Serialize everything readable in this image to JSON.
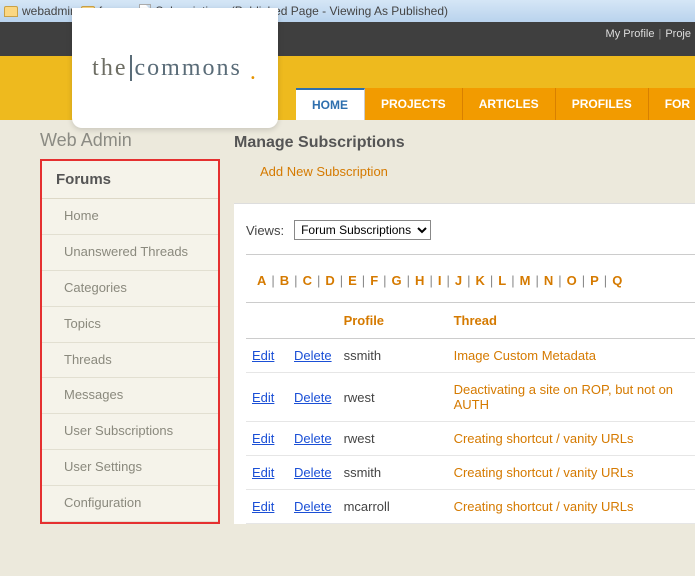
{
  "breadcrumb": {
    "item1": "webadmin",
    "item2": "forums",
    "item3": "Subscriptions (Published Page - Viewing As Published)"
  },
  "darkbar": {
    "my_profile": "My Profile",
    "proj": "Proje"
  },
  "logo": {
    "left": "the",
    "right": "commons",
    "dot": "."
  },
  "tabs": [
    {
      "label": "HOME",
      "active": true
    },
    {
      "label": "PROJECTS"
    },
    {
      "label": "ARTICLES"
    },
    {
      "label": "PROFILES"
    },
    {
      "label": "FOR"
    }
  ],
  "sidebar": {
    "title": "Web Admin",
    "section": "Forums",
    "items": [
      {
        "label": "Home"
      },
      {
        "label": "Unanswered Threads"
      },
      {
        "label": "Categories"
      },
      {
        "label": "Topics"
      },
      {
        "label": "Threads"
      },
      {
        "label": "Messages"
      },
      {
        "label": "User Subscriptions"
      },
      {
        "label": "User Settings"
      },
      {
        "label": "Configuration"
      }
    ]
  },
  "content": {
    "heading": "Manage Subscriptions",
    "add_link": "Add New Subscription",
    "views_label": "Views:",
    "views_selected": "Forum Subscriptions",
    "alpha": [
      "A",
      "B",
      "C",
      "D",
      "E",
      "F",
      "G",
      "H",
      "I",
      "J",
      "K",
      "L",
      "M",
      "N",
      "O",
      "P",
      "Q"
    ],
    "columns": {
      "profile": "Profile",
      "thread": "Thread"
    },
    "action_labels": {
      "edit": "Edit",
      "delete": "Delete"
    },
    "rows": [
      {
        "profile": "ssmith",
        "thread": "Image Custom Metadata"
      },
      {
        "profile": "rwest",
        "thread": "Deactivating a site on ROP, but not on AUTH"
      },
      {
        "profile": "rwest",
        "thread": "Creating shortcut / vanity URLs"
      },
      {
        "profile": "ssmith",
        "thread": "Creating shortcut / vanity URLs"
      },
      {
        "profile": "mcarroll",
        "thread": "Creating shortcut / vanity URLs"
      }
    ]
  }
}
